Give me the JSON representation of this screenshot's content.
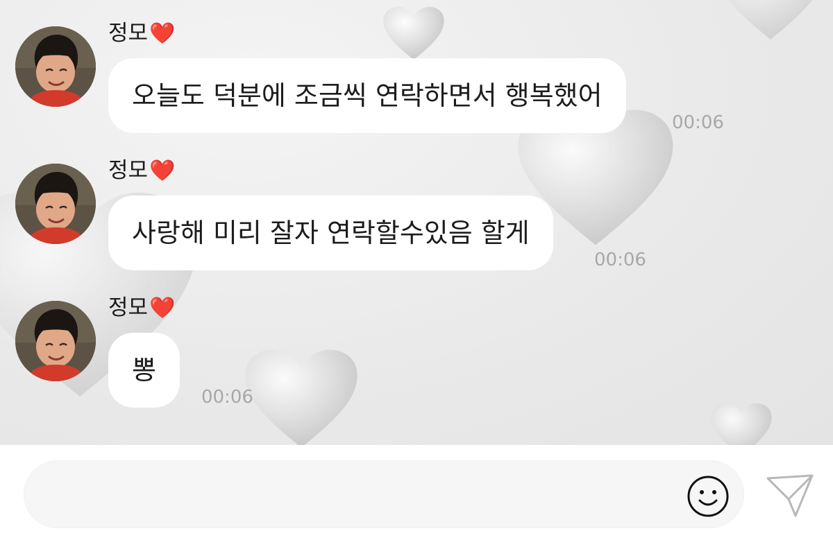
{
  "messages": [
    {
      "sender": "정모",
      "sender_emoji": "❤️",
      "text": "오늘도 덕분에 조금씩 연락하면서 행복했어",
      "time": "00:06"
    },
    {
      "sender": "정모",
      "sender_emoji": "❤️",
      "text": "사랑해 미리 잘자 연락할수있음 할게",
      "time": "00:06"
    },
    {
      "sender": "정모",
      "sender_emoji": "❤️",
      "text": "뽕",
      "time": "00:06"
    }
  ],
  "composer": {
    "value": "",
    "placeholder": ""
  },
  "icons": {
    "emoji": "smiley-face-icon",
    "send": "paper-plane-send-icon",
    "background": "heart-pattern"
  },
  "colors": {
    "bubble": "#ffffff",
    "chat_background": "#ececec",
    "timestamp": "#a8a8a8",
    "heart_emoji": "#e0142f"
  }
}
